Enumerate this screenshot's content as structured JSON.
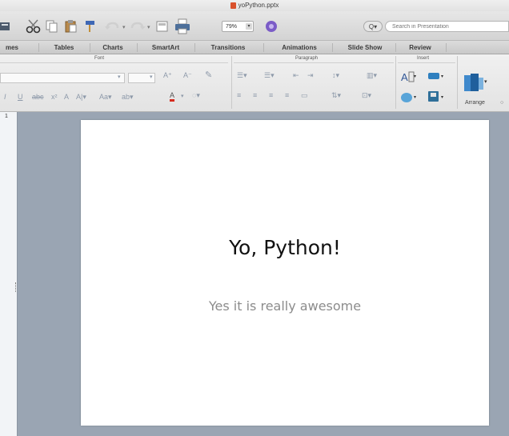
{
  "window": {
    "title": "yoPython.pptx"
  },
  "toolbar": {
    "zoom_value": "79%",
    "search_prefix": "Q▾",
    "search_placeholder": "Search in Presentation"
  },
  "ribbon_tabs": [
    "mes",
    "Tables",
    "Charts",
    "SmartArt",
    "Transitions",
    "Animations",
    "Slide Show",
    "Review"
  ],
  "ribbon_groups": {
    "font": "Font",
    "paragraph": "Paragraph",
    "insert": "Insert",
    "arrange_label": "Arrange"
  },
  "thumbnail_pane": {
    "slide_number": "1"
  },
  "slide": {
    "title": "Yo, Python!",
    "subtitle": "Yes it is really awesome"
  }
}
